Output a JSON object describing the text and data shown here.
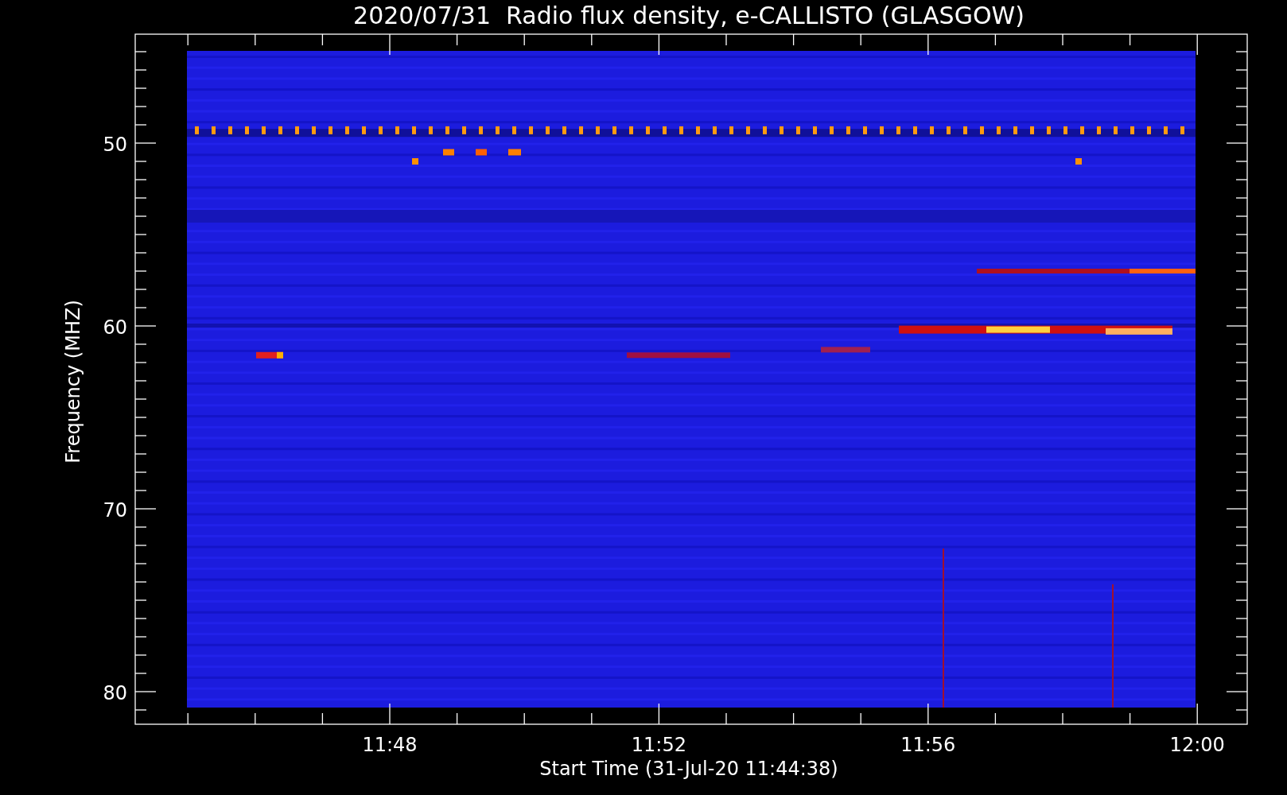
{
  "title": "2020/07/31  Radio flux density, e-CALLISTO (GLASGOW)",
  "y_axis": {
    "label": "Frequency (MHZ)",
    "ticks": [
      "50",
      "60",
      "70",
      "80"
    ]
  },
  "x_axis": {
    "label": "Start Time (31-Jul-20 11:44:38)",
    "ticks": [
      "11:48",
      "11:52",
      "11:56",
      "12:00"
    ]
  }
}
